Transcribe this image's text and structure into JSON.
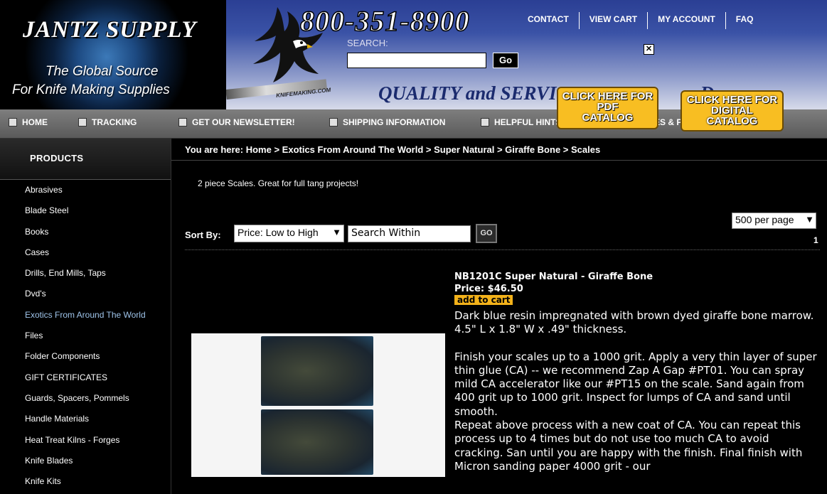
{
  "header": {
    "logo_title": "JANTZ SUPPLY",
    "logo_tagline_1": "The Global Source",
    "logo_tagline_2": "For Knife Making Supplies",
    "phone": "800-351-8900",
    "search_label": "SEARCH:",
    "search_value": "",
    "search_button": "Go",
    "close_glyph": "✕",
    "quality_text": "QUALITY and SERVICE",
    "quality_tail": "Dep",
    "knife_strip_text": "KNIFEMAKING.COM",
    "top_links": [
      "CONTACT",
      "VIEW CART",
      "MY ACCOUNT",
      "FAQ"
    ],
    "pdf_button": [
      "CLICK HERE FOR",
      "PDF",
      "CATALOG"
    ],
    "digital_button": [
      "CLICK HERE FOR",
      "DIGITAL",
      "CATALOG"
    ]
  },
  "nav": {
    "items": [
      "HOME",
      "TRACKING",
      "GET OUR NEWSLETTER!",
      "SHIPPING INFORMATION",
      "HELPFUL HINTS",
      "OUR POLICIES & PROCEDURES"
    ]
  },
  "sidebar": {
    "title": "PRODUCTS",
    "categories": [
      "Abrasives",
      "Blade Steel",
      "Books",
      "Cases",
      "Drills, End Mills, Taps",
      "Dvd's",
      "Exotics From Around The World",
      "Files",
      "Folder Components",
      "GIFT CERTIFICATES",
      "Guards, Spacers, Pommels",
      "Handle Materials",
      "Heat Treat Kilns - Forges",
      "Knife Blades",
      "Knife Kits"
    ],
    "active_index": 6
  },
  "main": {
    "breadcrumb": "You are here: Home > Exotics From Around The World > Super Natural > Giraffe Bone > Scales",
    "intro": "2 piece Scales. Great for full tang projects!",
    "per_page": "500 per page",
    "sort_label": "Sort By:",
    "sort_value": "Price: Low to High",
    "search_within_placeholder": "Search Within",
    "search_within_go": "GO",
    "page_number": "1"
  },
  "product": {
    "title": "NB1201C Super Natural - Giraffe Bone",
    "price": "Price: $46.50",
    "add_to_cart": "add to cart",
    "description": [
      "Dark blue resin impregnated with brown dyed giraffe bone marrow.",
      "4.5\" L x 1.8\" W x .49\" thickness.",
      "",
      "Finish your scales up to a 1000 grit. Apply a very thin layer of super thin glue (CA) -- we recommend Zap A Gap #PT01. You can spray mild CA accelerator like our #PT15 on the scale. Sand again from 400 grit up to 1000 grit. Inspect for lumps of CA and sand until smooth.",
      "Repeat above process with a new coat of CA. You can repeat this process up to 4 times but do not use too much CA to avoid cracking. San until you are happy with the finish. Final finish with Micron sanding paper 4000 grit - our"
    ]
  },
  "colors": {
    "background": "#000000",
    "nav_bar": "#6a6a6a",
    "banner_blue": "#2b3f94",
    "catalog_button": "#f8be22",
    "add_to_cart": "#f3b21a",
    "active_link": "#9fc4ea"
  }
}
